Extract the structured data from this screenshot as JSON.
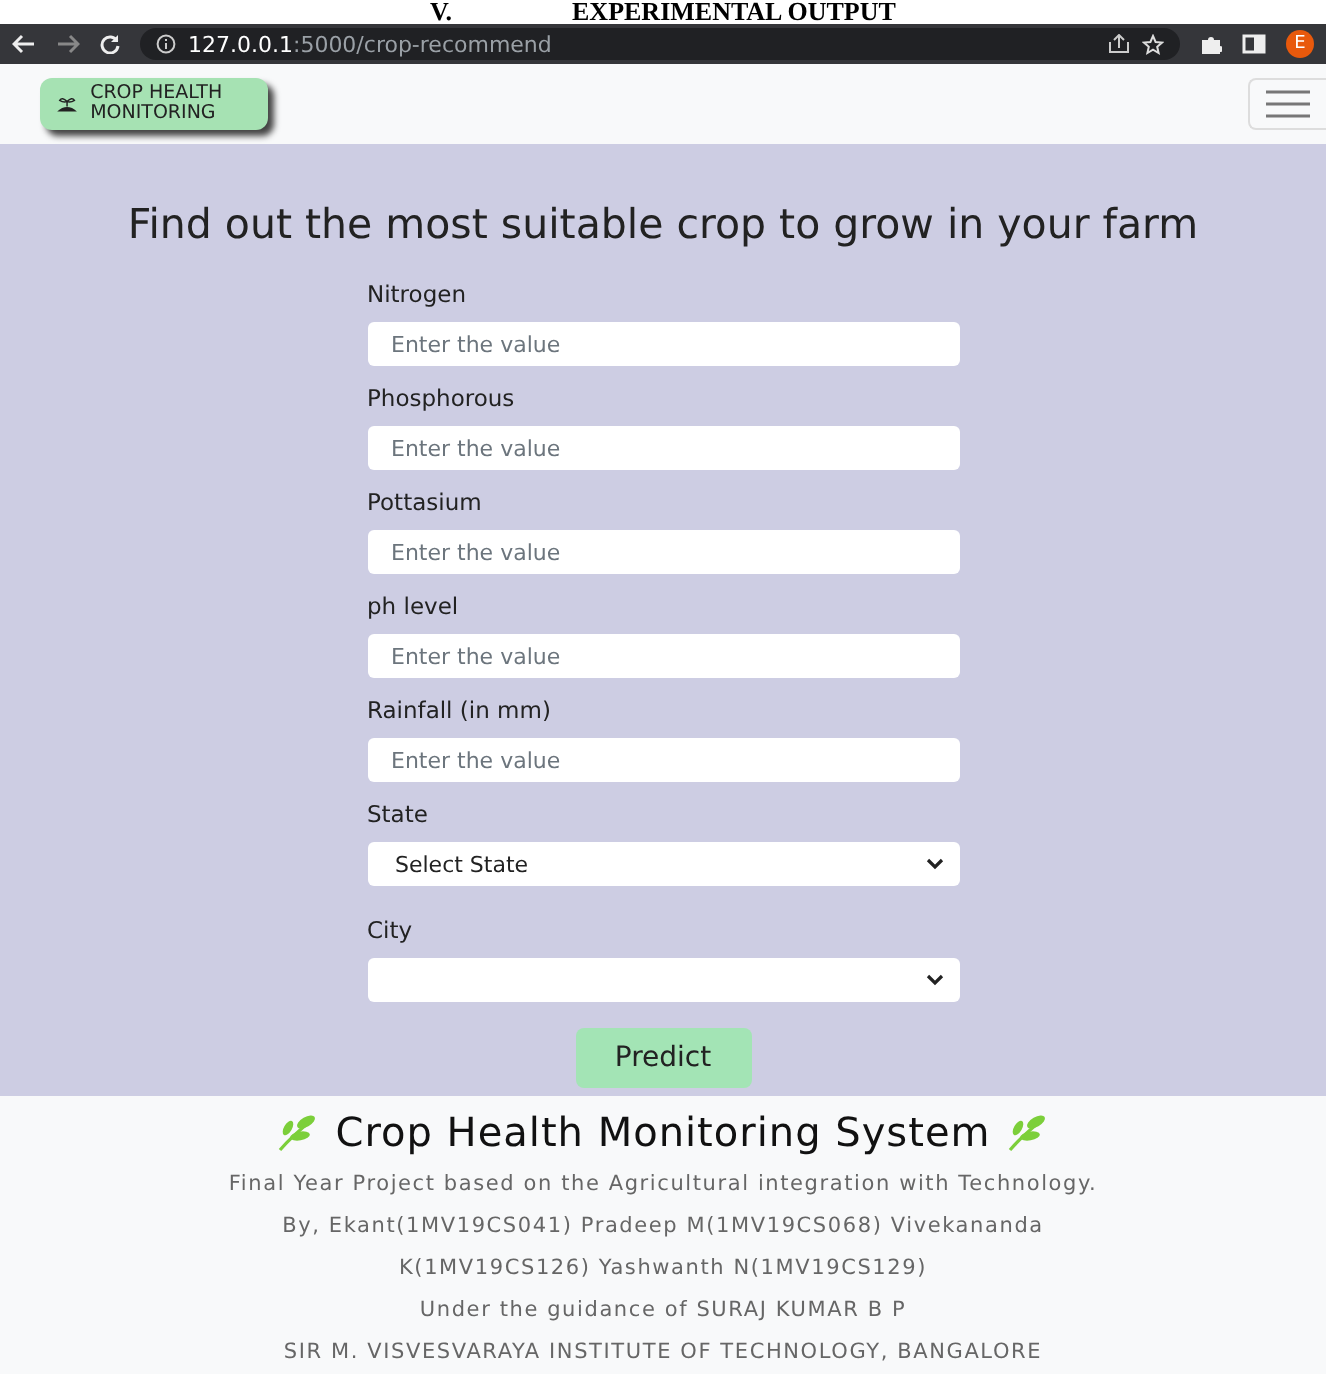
{
  "document_heading": {
    "number": "V.",
    "title": "EXPERIMENTAL OUTPUT"
  },
  "browser": {
    "url_host": "127.0.0.1",
    "url_path": ":5000/crop-recommend",
    "profile_initial": "E"
  },
  "navbar": {
    "brand": "CROP HEALTH MONITORING"
  },
  "form": {
    "heading": "Find out the most suitable crop to grow in your farm",
    "fields": [
      {
        "kind": "input",
        "label": "Nitrogen",
        "placeholder": "Enter the value"
      },
      {
        "kind": "input",
        "label": "Phosphorous",
        "placeholder": "Enter the value"
      },
      {
        "kind": "input",
        "label": "Pottasium",
        "placeholder": "Enter the value"
      },
      {
        "kind": "input",
        "label": "ph level",
        "placeholder": "Enter the value"
      },
      {
        "kind": "input",
        "label": "Rainfall (in mm)",
        "placeholder": "Enter the value"
      },
      {
        "kind": "select",
        "label": "State",
        "value": "Select State"
      },
      {
        "kind": "select",
        "label": "City"
      }
    ],
    "submit": "Predict"
  },
  "footer": {
    "title": "Crop Health Monitoring System",
    "lines": [
      "Final Year Project based on the Agricultural integration with Technology.",
      "By, Ekant(1MV19CS041) Pradeep M(1MV19CS068) Vivekananda",
      "K(1MV19CS126) Yashwanth N(1MV19CS129)",
      "Under the guidance of SURAJ KUMAR B P",
      "SIR M. VISVESVARAYA INSTITUTE OF TECHNOLOGY, BANGALORE"
    ]
  }
}
